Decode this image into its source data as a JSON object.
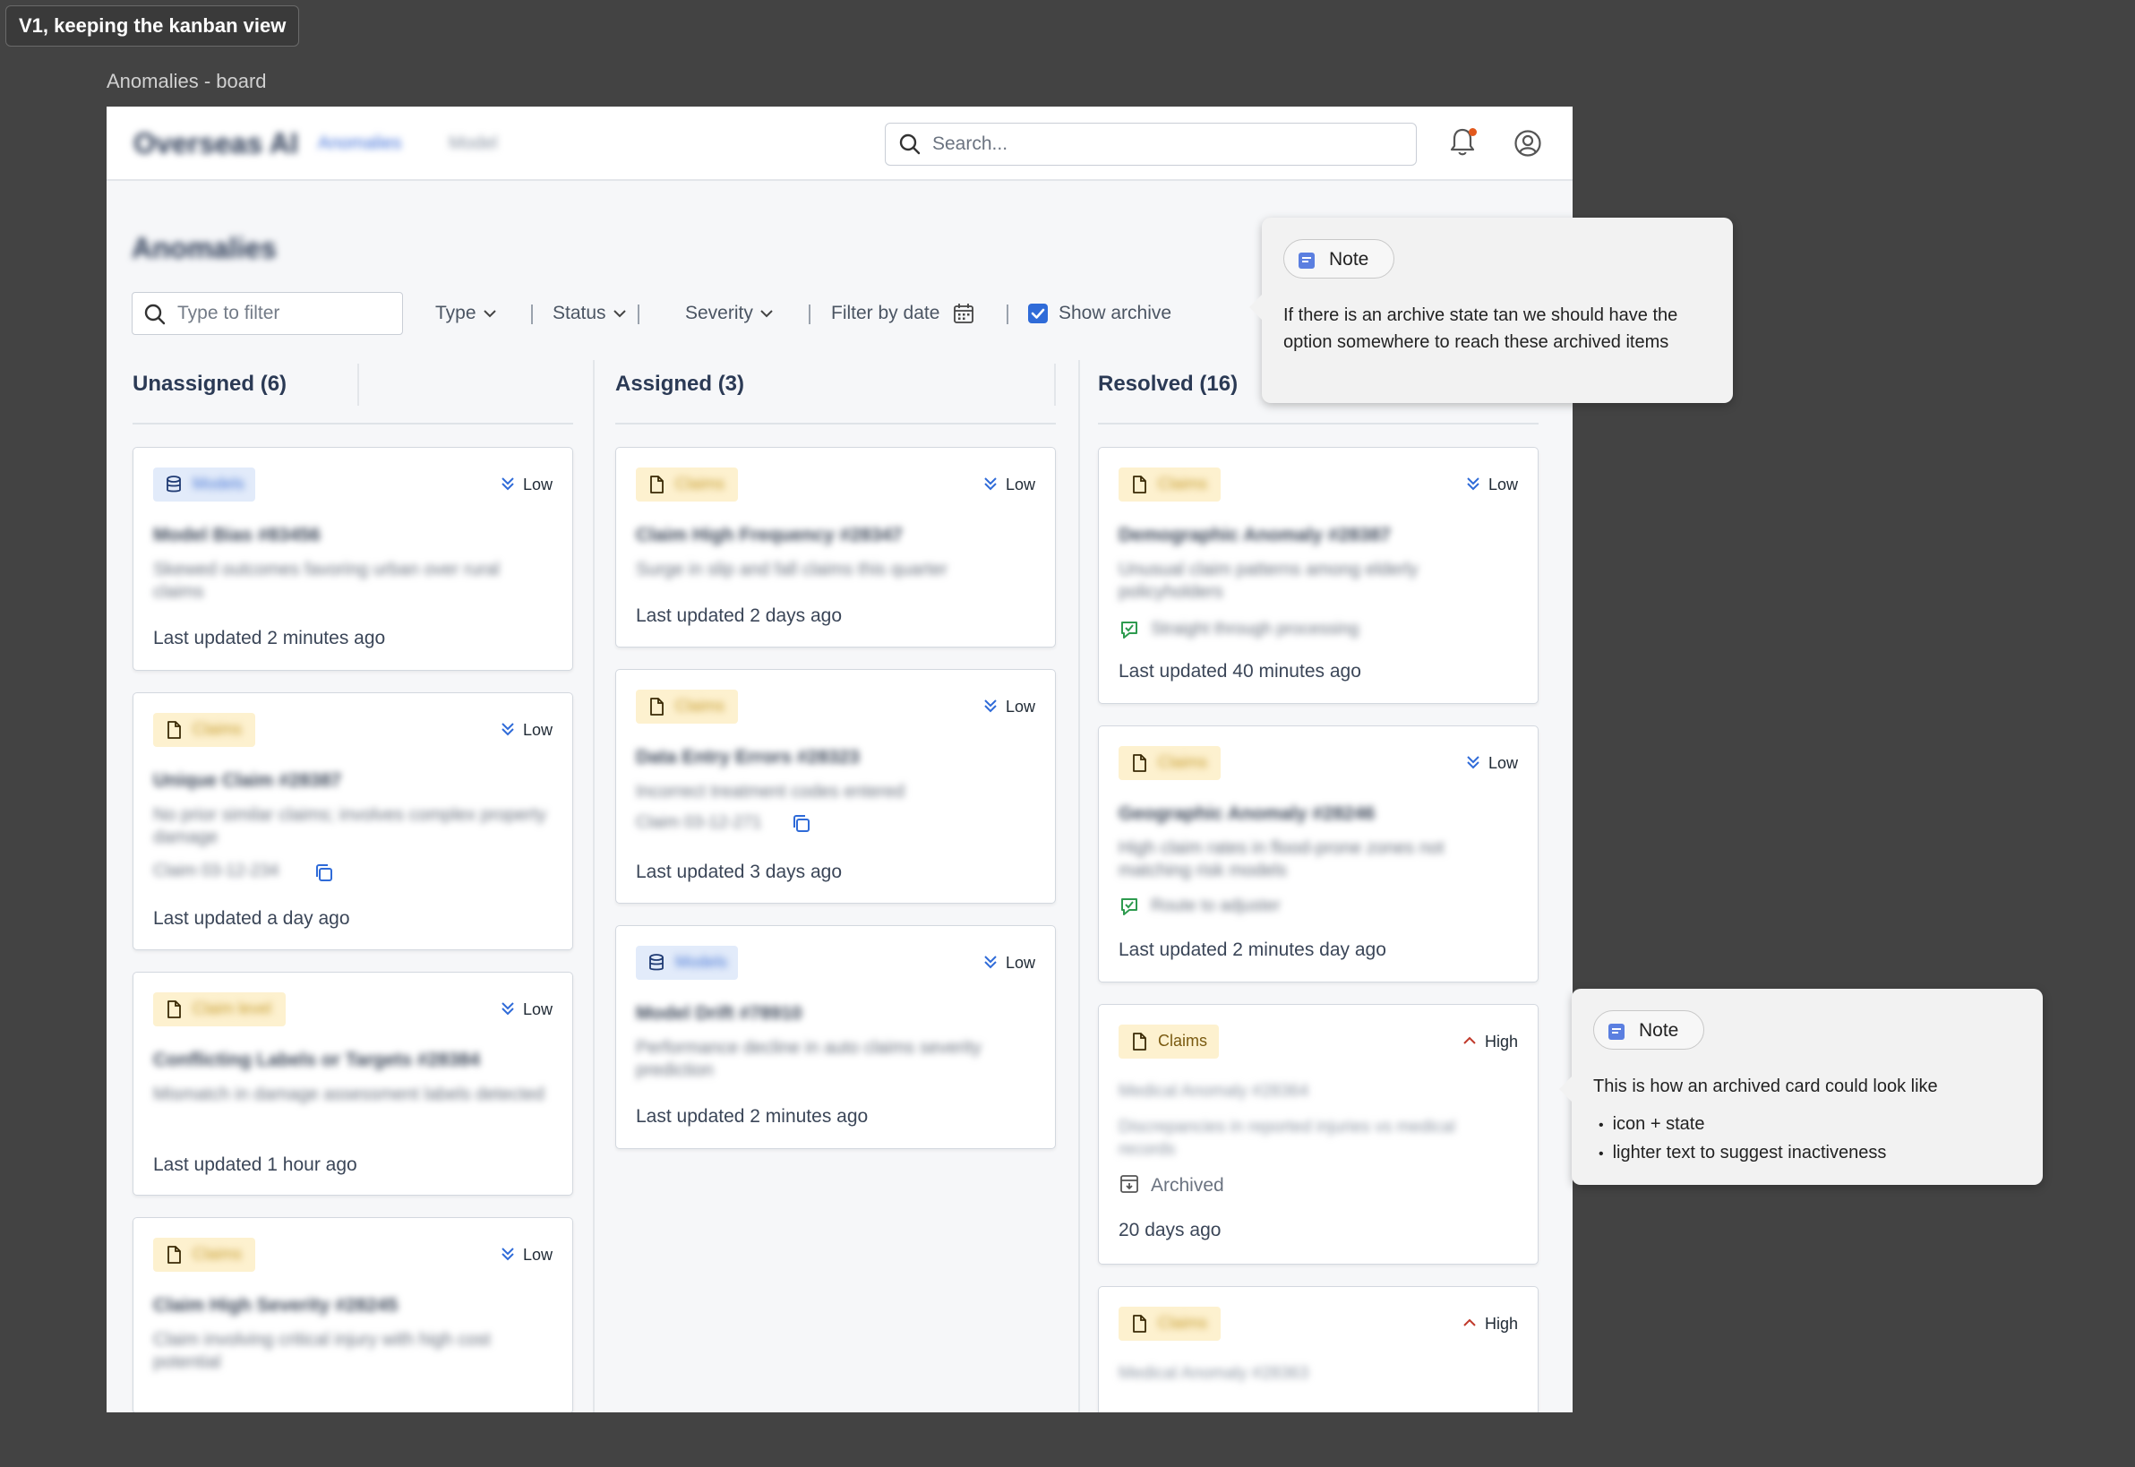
{
  "frame_tag": "V1, keeping the kanban view",
  "frame_label": "Anomalies - board",
  "topbar": {
    "logo": "Overseas AI",
    "nav": [
      "Anomalies",
      "Model"
    ],
    "search_placeholder": "Search..."
  },
  "page_title": "Anomalies",
  "filters": {
    "search_placeholder": "Type to filter",
    "type": "Type",
    "status": "Status",
    "severity": "Severity",
    "date": "Filter by date",
    "show_archive": "Show archive"
  },
  "columns": [
    {
      "title": "Unassigned (6)",
      "cards": [
        {
          "tag": "Models",
          "tag_kind": "models",
          "priority": "Low",
          "title": "Model Bias #83456",
          "desc": "Skewed outcomes favoring urban over rural claims",
          "footer": "Last updated 2 minutes ago"
        },
        {
          "tag": "Claims",
          "tag_kind": "claims",
          "priority": "Low",
          "title": "Unique Claim #28387",
          "desc": "No prior similar claims; involves complex property damage",
          "extra": "Claim 03-12-234",
          "footer": "Last updated a day ago"
        },
        {
          "tag": "Claim level",
          "tag_kind": "claims",
          "priority": "Low",
          "title": "Conflicting Labels or Targets #28384",
          "desc": "Mismatch in damage assessment labels detected",
          "footer": "Last updated 1 hour ago"
        },
        {
          "tag": "Claims",
          "tag_kind": "claims",
          "priority": "Low",
          "title": "Claim High Severity #28245",
          "desc": "Claim involving critical injury with high cost potential"
        }
      ]
    },
    {
      "title": "Assigned (3)",
      "cards": [
        {
          "tag": "Claims",
          "tag_kind": "claims",
          "priority": "Low",
          "title": "Claim High Frequency #28347",
          "desc": "Surge in slip and fall claims this quarter",
          "footer": "Last updated 2 days ago"
        },
        {
          "tag": "Claims",
          "tag_kind": "claims",
          "priority": "Low",
          "title": "Data Entry Errors #28323",
          "desc": "Incorrect treatment codes entered",
          "extra": "Claim 03-12-271",
          "footer": "Last updated 3 days ago"
        },
        {
          "tag": "Models",
          "tag_kind": "models",
          "priority": "Low",
          "title": "Model Drift #78910",
          "desc": "Performance decline in auto claims severity prediction",
          "footer": "Last updated 2 minutes ago"
        }
      ]
    },
    {
      "title": "Resolved (16)",
      "cards": [
        {
          "tag": "Claims",
          "tag_kind": "claims",
          "priority": "Low",
          "title": "Demographic Anomaly #28387",
          "desc": "Unusual claim patterns among elderly policyholders",
          "extra": "Straight through processing",
          "footer": "Last updated 40 minutes ago"
        },
        {
          "tag": "Claims",
          "tag_kind": "claims",
          "priority": "Low",
          "title": "Geographic Anomaly #28246",
          "desc": "High claim rates in flood-prone zones not matching risk models",
          "extra": "Route to adjuster",
          "footer": "Last updated 2 minutes day ago"
        },
        {
          "tag": "Claims",
          "tag_kind": "claims",
          "priority": "High",
          "title": "Medical Anomaly #28364",
          "desc": "Discrepancies in reported injuries vs medical records",
          "state": "Archived",
          "footer": "20 days ago"
        },
        {
          "tag": "Claims",
          "tag_kind": "claims",
          "priority": "High",
          "title": "Medical Anomaly #28363"
        }
      ]
    }
  ],
  "notes": [
    {
      "label": "Note",
      "body": "If there is an archive state tan we should have the option somewhere to reach these archived items"
    },
    {
      "label": "Note",
      "body": "This is how an archived card could look like",
      "bullets": [
        "icon + state",
        "lighter text to suggest inactiveness"
      ]
    }
  ],
  "colors": {
    "accent": "#2f6bd8",
    "claims_tag_bg": "#fdf1cf",
    "models_tag_bg": "#e2ebfa",
    "high_priority": "#c0392b",
    "low_priority": "#2f6bd8",
    "notification_dot": "#e2591d"
  }
}
